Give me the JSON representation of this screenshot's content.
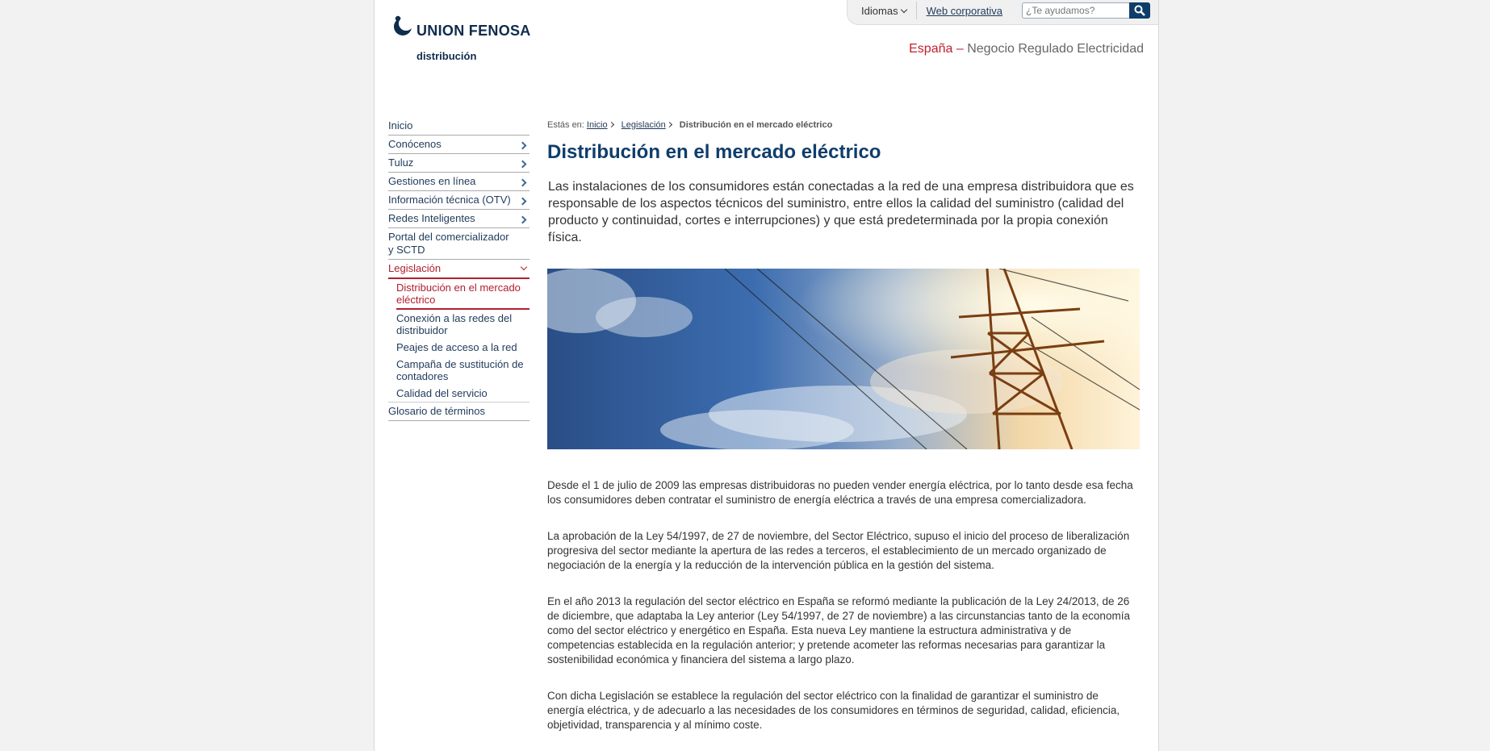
{
  "topbar": {
    "languages_label": "Idiomas",
    "corporate_link": "Web corporativa",
    "search_placeholder": "¿Te ayudamos?"
  },
  "logo": {
    "name": "UNION FENOSA",
    "subtitle": "distribución"
  },
  "region": {
    "country": "España",
    "dash": "–",
    "business": "Negocio Regulado Electricidad"
  },
  "sidebar": {
    "items": [
      {
        "label": "Inicio",
        "has_arrow": false
      },
      {
        "label": "Conócenos",
        "has_arrow": true
      },
      {
        "label": "Tuluz",
        "has_arrow": true
      },
      {
        "label": "Gestiones en línea",
        "has_arrow": true
      },
      {
        "label": "Información técnica (OTV)",
        "has_arrow": true
      },
      {
        "label": "Redes Inteligentes",
        "has_arrow": true
      },
      {
        "label": "Portal del comercializador y SCTD",
        "has_arrow": false
      },
      {
        "label": "Legislación",
        "expanded": true
      },
      {
        "label": "Glosario de términos",
        "has_arrow": false
      }
    ],
    "subitems": [
      {
        "label": "Distribución en el mercado eléctrico",
        "current": true
      },
      {
        "label": "Conexión a las redes del distribuidor"
      },
      {
        "label": "Peajes de acceso a la red"
      },
      {
        "label": "Campaña de sustitución de contadores"
      },
      {
        "label": "Calidad del servicio"
      }
    ]
  },
  "breadcrumb": {
    "prefix": "Estás en:",
    "links": [
      "Inicio",
      "Legislación"
    ],
    "current": "Distribución en el mercado eléctrico"
  },
  "main": {
    "title": "Distribución en el mercado eléctrico",
    "lead": "Las instalaciones de los consumidores están conectadas a la red de una empresa distribuidora que es responsable de los aspectos técnicos del suministro, entre ellos la calidad del suministro (calidad del producto y continuidad, cortes e interrupciones) y que está predeterminada por la propia conexión física.",
    "paragraphs": [
      "Desde el 1 de julio de 2009 las empresas distribuidoras no pueden vender energía eléctrica, por lo tanto desde esa fecha los consumidores deben contratar el suministro de energía eléctrica a través de una empresa comercializadora.",
      "La aprobación de la Ley 54/1997, de 27 de noviembre, del Sector Eléctrico, supuso el inicio del proceso de liberalización progresiva del sector mediante la apertura de las redes a terceros, el establecimiento de un mercado organizado de negociación de la energía y la reducción de la intervención pública en la gestión del sistema.",
      "En el año 2013 la regulación del sector eléctrico en España se reformó mediante la publicación de la Ley 24/2013, de 26 de diciembre, que adaptaba la Ley anterior (Ley 54/1997, de 27 de noviembre) a las circunstancias tanto de la economía como del sector eléctrico y energético en España. Esta nueva Ley mantiene la estructura administrativa y de competencias establecida en la regulación anterior; y pretende acometer las reformas necesarias para garantizar la sostenibilidad económica y financiera del sistema a largo plazo.",
      "Con dicha Legislación se establece la regulación del sector eléctrico con la finalidad de garantizar el suministro de energía eléctrica, y de adecuarlo a las necesidades de los consumidores en términos de seguridad, calidad, eficiencia, objetividad, transparencia y al mínimo coste."
    ]
  },
  "colors": {
    "brand_navy": "#0f2c4c",
    "title_blue": "#0f3d6b",
    "accent_red": "#b0202e"
  }
}
